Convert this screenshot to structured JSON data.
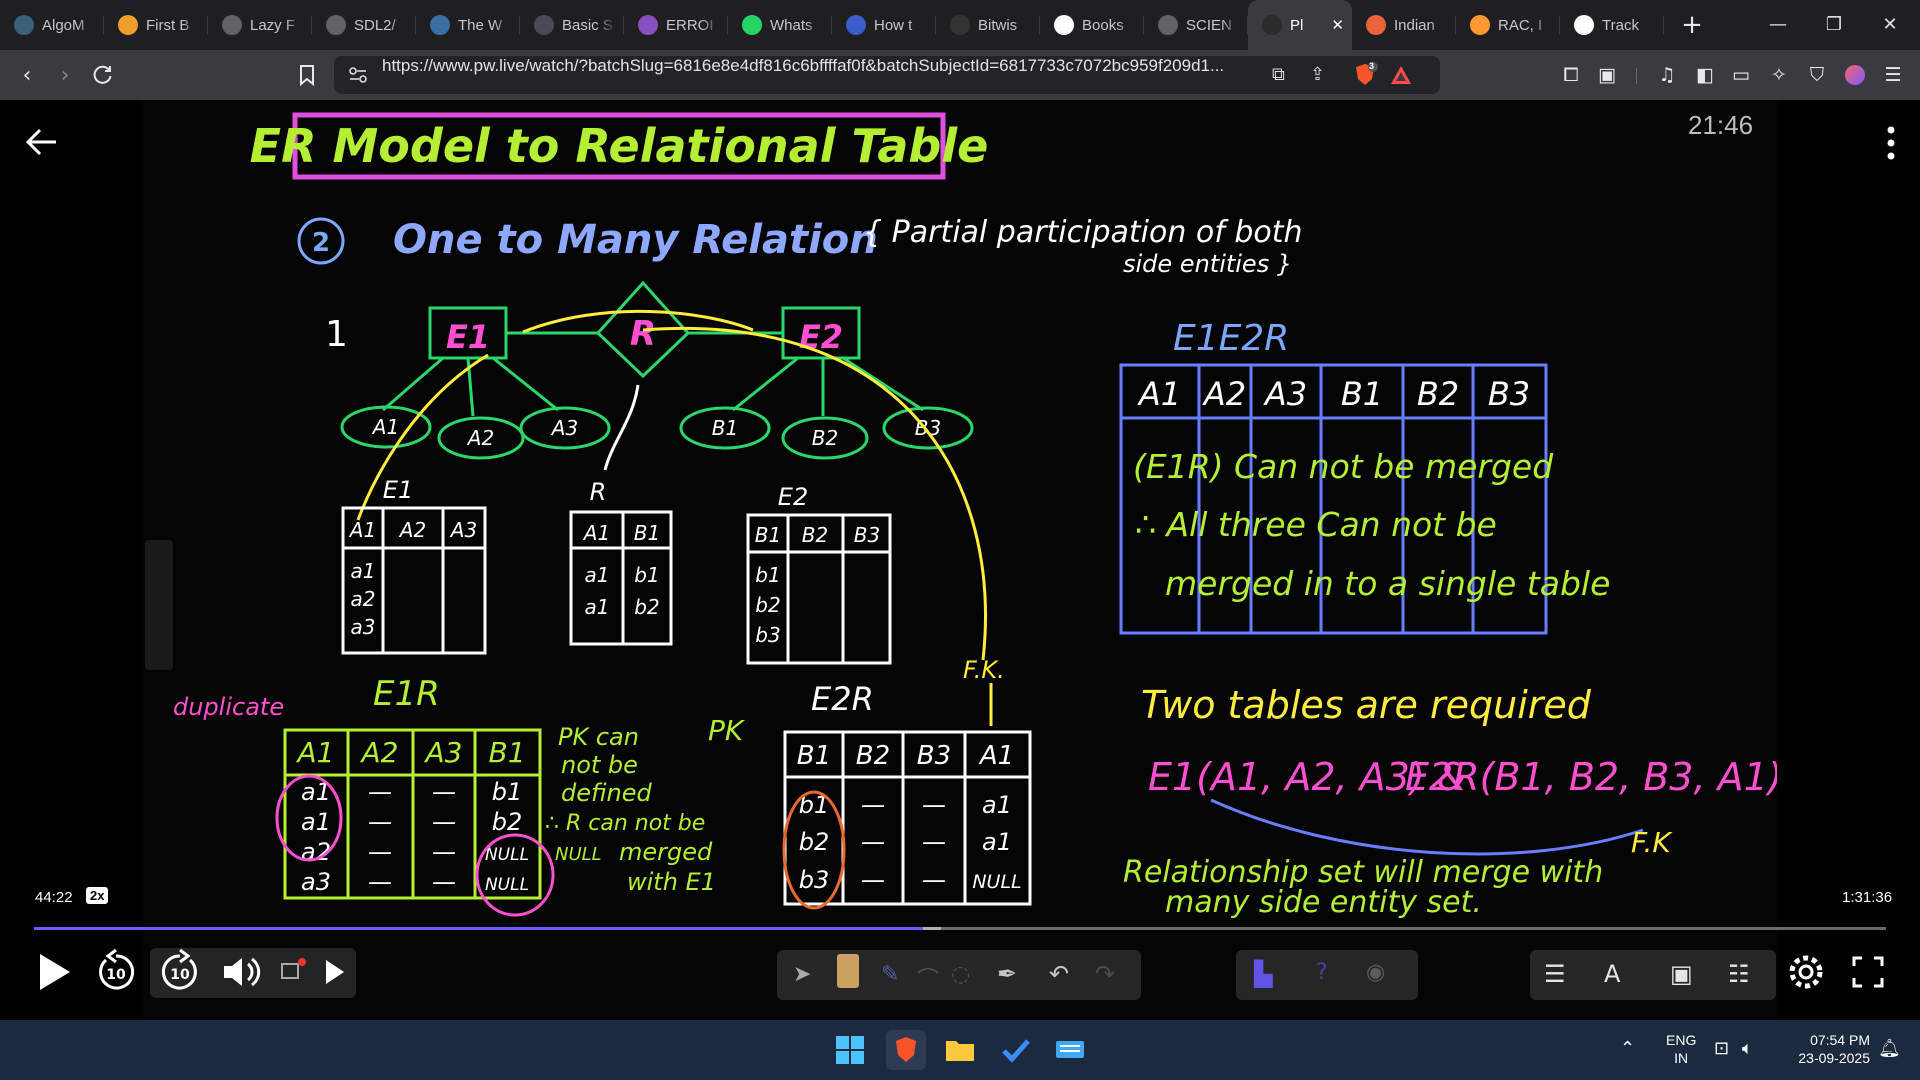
{
  "browser": {
    "tabs": [
      {
        "title": "AlgoM",
        "icon": "algomonster-icon",
        "color": "#3a5f7a"
      },
      {
        "title": "First B",
        "icon": "first-bad-version-icon",
        "color": "#f29b2f"
      },
      {
        "title": "Lazy F",
        "icon": "lazy-icon",
        "color": "#5f6368"
      },
      {
        "title": "SDL2/",
        "icon": "sdl-icon",
        "color": "#5f6368"
      },
      {
        "title": "The W",
        "icon": "wordpress-icon",
        "color": "#3a6ea5"
      },
      {
        "title": "Basic S",
        "icon": "basic-icon",
        "color": "#4a4a52"
      },
      {
        "title": "ERROI",
        "icon": "error-icon",
        "color": "#8a4fbf"
      },
      {
        "title": "Whats",
        "icon": "whatsapp-icon",
        "color": "#25d366"
      },
      {
        "title": "How t",
        "icon": "howto-icon",
        "color": "#3c5cc9"
      },
      {
        "title": "Bitwis",
        "icon": "bitwise-icon",
        "color": "#333333"
      },
      {
        "title": "Books",
        "icon": "google-icon",
        "color": "#ffffff"
      },
      {
        "title": "SCIEN",
        "icon": "science-icon",
        "color": "#5f6368"
      },
      {
        "title": "Pl",
        "icon": "pw-icon",
        "color": "#2b2b2b"
      },
      {
        "title": "Indian",
        "icon": "indian-icon",
        "color": "#e8643a"
      },
      {
        "title": "RAC, I",
        "icon": "india-flag-icon",
        "color": "#ff9933"
      },
      {
        "title": "Track",
        "icon": "amazon-icon",
        "color": "#ffffff"
      }
    ],
    "active_tab_index": 12,
    "close_tab_glyph": "✕",
    "new_tab_glyph": "+",
    "url": "https://www.pw.live/watch/?batchSlug=6816e8e4df816c6bffffaf0f&batchSubjectId=6817733c7072bc959f209d1...",
    "brave_shield_count": "3"
  },
  "lecture": {
    "title": "ER Model to Relational Table",
    "subtitle_num": "2",
    "subtitle": "One to Many Relation",
    "subtitle_note_1": "{ Partial participation of both",
    "subtitle_note_2": "side entities }",
    "card_1": "1",
    "diagram": {
      "entity_1": "E1",
      "relationship": "R",
      "entity_2": "E2",
      "attrs": [
        "A1",
        "A2",
        "A3",
        "B1",
        "B2",
        "B3"
      ]
    },
    "small_tables": {
      "e1": {
        "label": "E1",
        "headers": [
          "A1",
          "A2",
          "A3"
        ],
        "rows": [
          "a1",
          "a2",
          "a3"
        ]
      },
      "r": {
        "label": "R",
        "headers": [
          "A1",
          "B1"
        ],
        "rows": [
          [
            "a1",
            "b1"
          ],
          [
            "a1",
            "b2"
          ]
        ]
      },
      "e2": {
        "label": "E2",
        "headers": [
          "B1",
          "B2",
          "B3"
        ],
        "rows": [
          "b1",
          "b2",
          "b3"
        ]
      }
    },
    "e1r": {
      "label": "E1R",
      "headers": [
        "A1",
        "A2",
        "A3",
        "B1"
      ],
      "rows": [
        [
          "a1",
          "—",
          "—",
          "b1"
        ],
        [
          "a1",
          "—",
          "—",
          "b2"
        ],
        [
          "a2",
          "—",
          "—",
          "NULL"
        ],
        [
          "a3",
          "—",
          "—",
          "NULL"
        ]
      ],
      "duplicate_note": "duplicate",
      "note_lines": [
        "PK can",
        "not be",
        "defined",
        "∴ R can not be",
        "merged",
        "with E1"
      ],
      "note_null": "NULL"
    },
    "e2r": {
      "label": "E2R",
      "pk_note": "PK",
      "fk_note": "F.K.",
      "headers": [
        "B1",
        "B2",
        "B3",
        "A1"
      ],
      "rows": [
        [
          "b1",
          "—",
          "—",
          "a1"
        ],
        [
          "b2",
          "—",
          "—",
          "a1"
        ],
        [
          "b3",
          "—",
          "—",
          "NULL"
        ]
      ]
    },
    "e1e2r": {
      "label": "E1E2R",
      "headers": [
        "A1",
        "A2",
        "A3",
        "B1",
        "B2",
        "B3"
      ],
      "note_lines": [
        "(E1R) Can not be merged",
        "∴ All three Can not be",
        "merged in to a single table"
      ]
    },
    "conclusion": {
      "line1": "Two tables are required",
      "line2a": "E1(A1, A2, A3) &",
      "line2b": "E2R(B1, B2, B3, A1)",
      "fk": "F.K",
      "line3": "Relationship set will merge with",
      "line4": "many side entity set."
    }
  },
  "player": {
    "clock": "21:46",
    "current_time": "44:22",
    "speed": "2x",
    "duration": "1:31:36",
    "progress": 0.48,
    "buffered": 0.49,
    "seek_back_seconds": "10",
    "seek_forward_seconds": "10"
  },
  "taskbar": {
    "lang_1": "ENG",
    "lang_2": "IN",
    "time": "07:54 PM",
    "date": "23-09-2025"
  }
}
